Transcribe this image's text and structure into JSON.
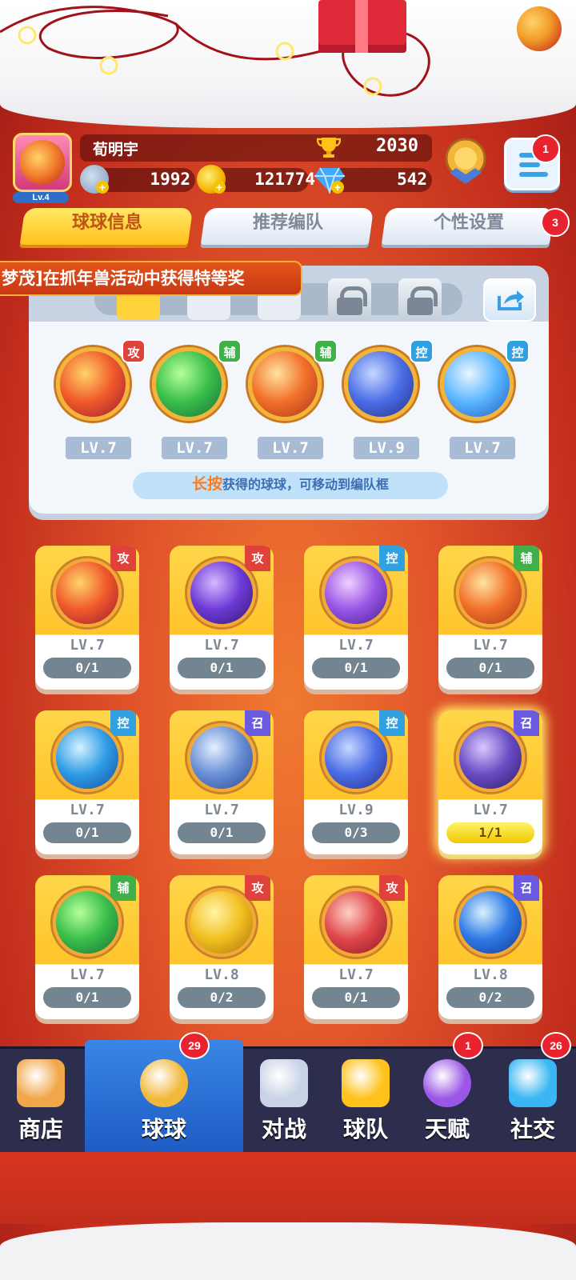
{
  "player": {
    "name": "荀明宇",
    "level": "Lv.4",
    "trophies": "2030",
    "stars": "1992",
    "gold": "121774",
    "gems": "542"
  },
  "menu_badge": "1",
  "settings_badge": "3",
  "tabs": [
    {
      "label": "球球信息",
      "active": true
    },
    {
      "label": "推荐编队",
      "active": false
    },
    {
      "label": "个性设置",
      "active": false
    }
  ],
  "ticker": "梦茂]在抓年兽活动中获得特等奖",
  "team": [
    {
      "tag": "攻",
      "level": "LV.7",
      "tag_color": "#e0413a",
      "orb": "dragon-orb"
    },
    {
      "tag": "辅",
      "level": "LV.7",
      "tag_color": "#3fb04a",
      "orb": "arrow-orb"
    },
    {
      "tag": "辅",
      "level": "LV.7",
      "tag_color": "#3fb04a",
      "orb": "wings-orb"
    },
    {
      "tag": "控",
      "level": "LV.9",
      "tag_color": "#2fa0e0",
      "orb": "clock-orb"
    },
    {
      "tag": "控",
      "level": "LV.7",
      "tag_color": "#2fa0e0",
      "orb": "snowflake-orb"
    }
  ],
  "hint": {
    "highlight": "长按",
    "text": "获得的球球，可移动到编队框"
  },
  "cards": [
    {
      "tag": "攻",
      "tag_color": "#e0413a",
      "level": "LV.7",
      "count": "0/1",
      "orb": "dragon-orb"
    },
    {
      "tag": "攻",
      "tag_color": "#e0413a",
      "level": "LV.7",
      "count": "0/1",
      "orb": "sword-orb"
    },
    {
      "tag": "控",
      "tag_color": "#2fa0e0",
      "level": "LV.7",
      "count": "0/1",
      "orb": "butterfly-orb"
    },
    {
      "tag": "辅",
      "tag_color": "#3fb04a",
      "level": "LV.7",
      "count": "0/1",
      "orb": "wings-orb"
    },
    {
      "tag": "控",
      "tag_color": "#2fa0e0",
      "level": "LV.7",
      "count": "0/1",
      "orb": "wave-orb"
    },
    {
      "tag": "召",
      "tag_color": "#6a5ae0",
      "level": "LV.7",
      "count": "0/1",
      "orb": "whirlwind-orb"
    },
    {
      "tag": "控",
      "tag_color": "#2fa0e0",
      "level": "LV.9",
      "count": "0/3",
      "orb": "clock-orb"
    },
    {
      "tag": "召",
      "tag_color": "#6a5ae0",
      "level": "LV.7",
      "count": "1/1",
      "orb": "ghost-orb"
    },
    {
      "tag": "辅",
      "tag_color": "#3fb04a",
      "level": "LV.7",
      "count": "0/1",
      "orb": "arrow-orb"
    },
    {
      "tag": "攻",
      "tag_color": "#e0413a",
      "level": "LV.8",
      "count": "0/2",
      "orb": "shuriken-orb"
    },
    {
      "tag": "攻",
      "tag_color": "#e0413a",
      "level": "LV.7",
      "count": "0/1",
      "orb": "fist-orb"
    },
    {
      "tag": "召",
      "tag_color": "#6a5ae0",
      "level": "LV.8",
      "count": "0/2",
      "orb": "ice-wall-orb"
    }
  ],
  "nav": [
    {
      "label": "商店",
      "icon": "shop-icon",
      "badge": ""
    },
    {
      "label": "球球",
      "icon": "ball-icon",
      "badge": "29"
    },
    {
      "label": "对战",
      "icon": "crossed-swords-icon",
      "badge": ""
    },
    {
      "label": "球队",
      "icon": "whistle-icon",
      "badge": ""
    },
    {
      "label": "天赋",
      "icon": "talent-orb-icon",
      "badge": "1"
    },
    {
      "label": "社交",
      "icon": "chat-icon",
      "badge": "26"
    }
  ]
}
